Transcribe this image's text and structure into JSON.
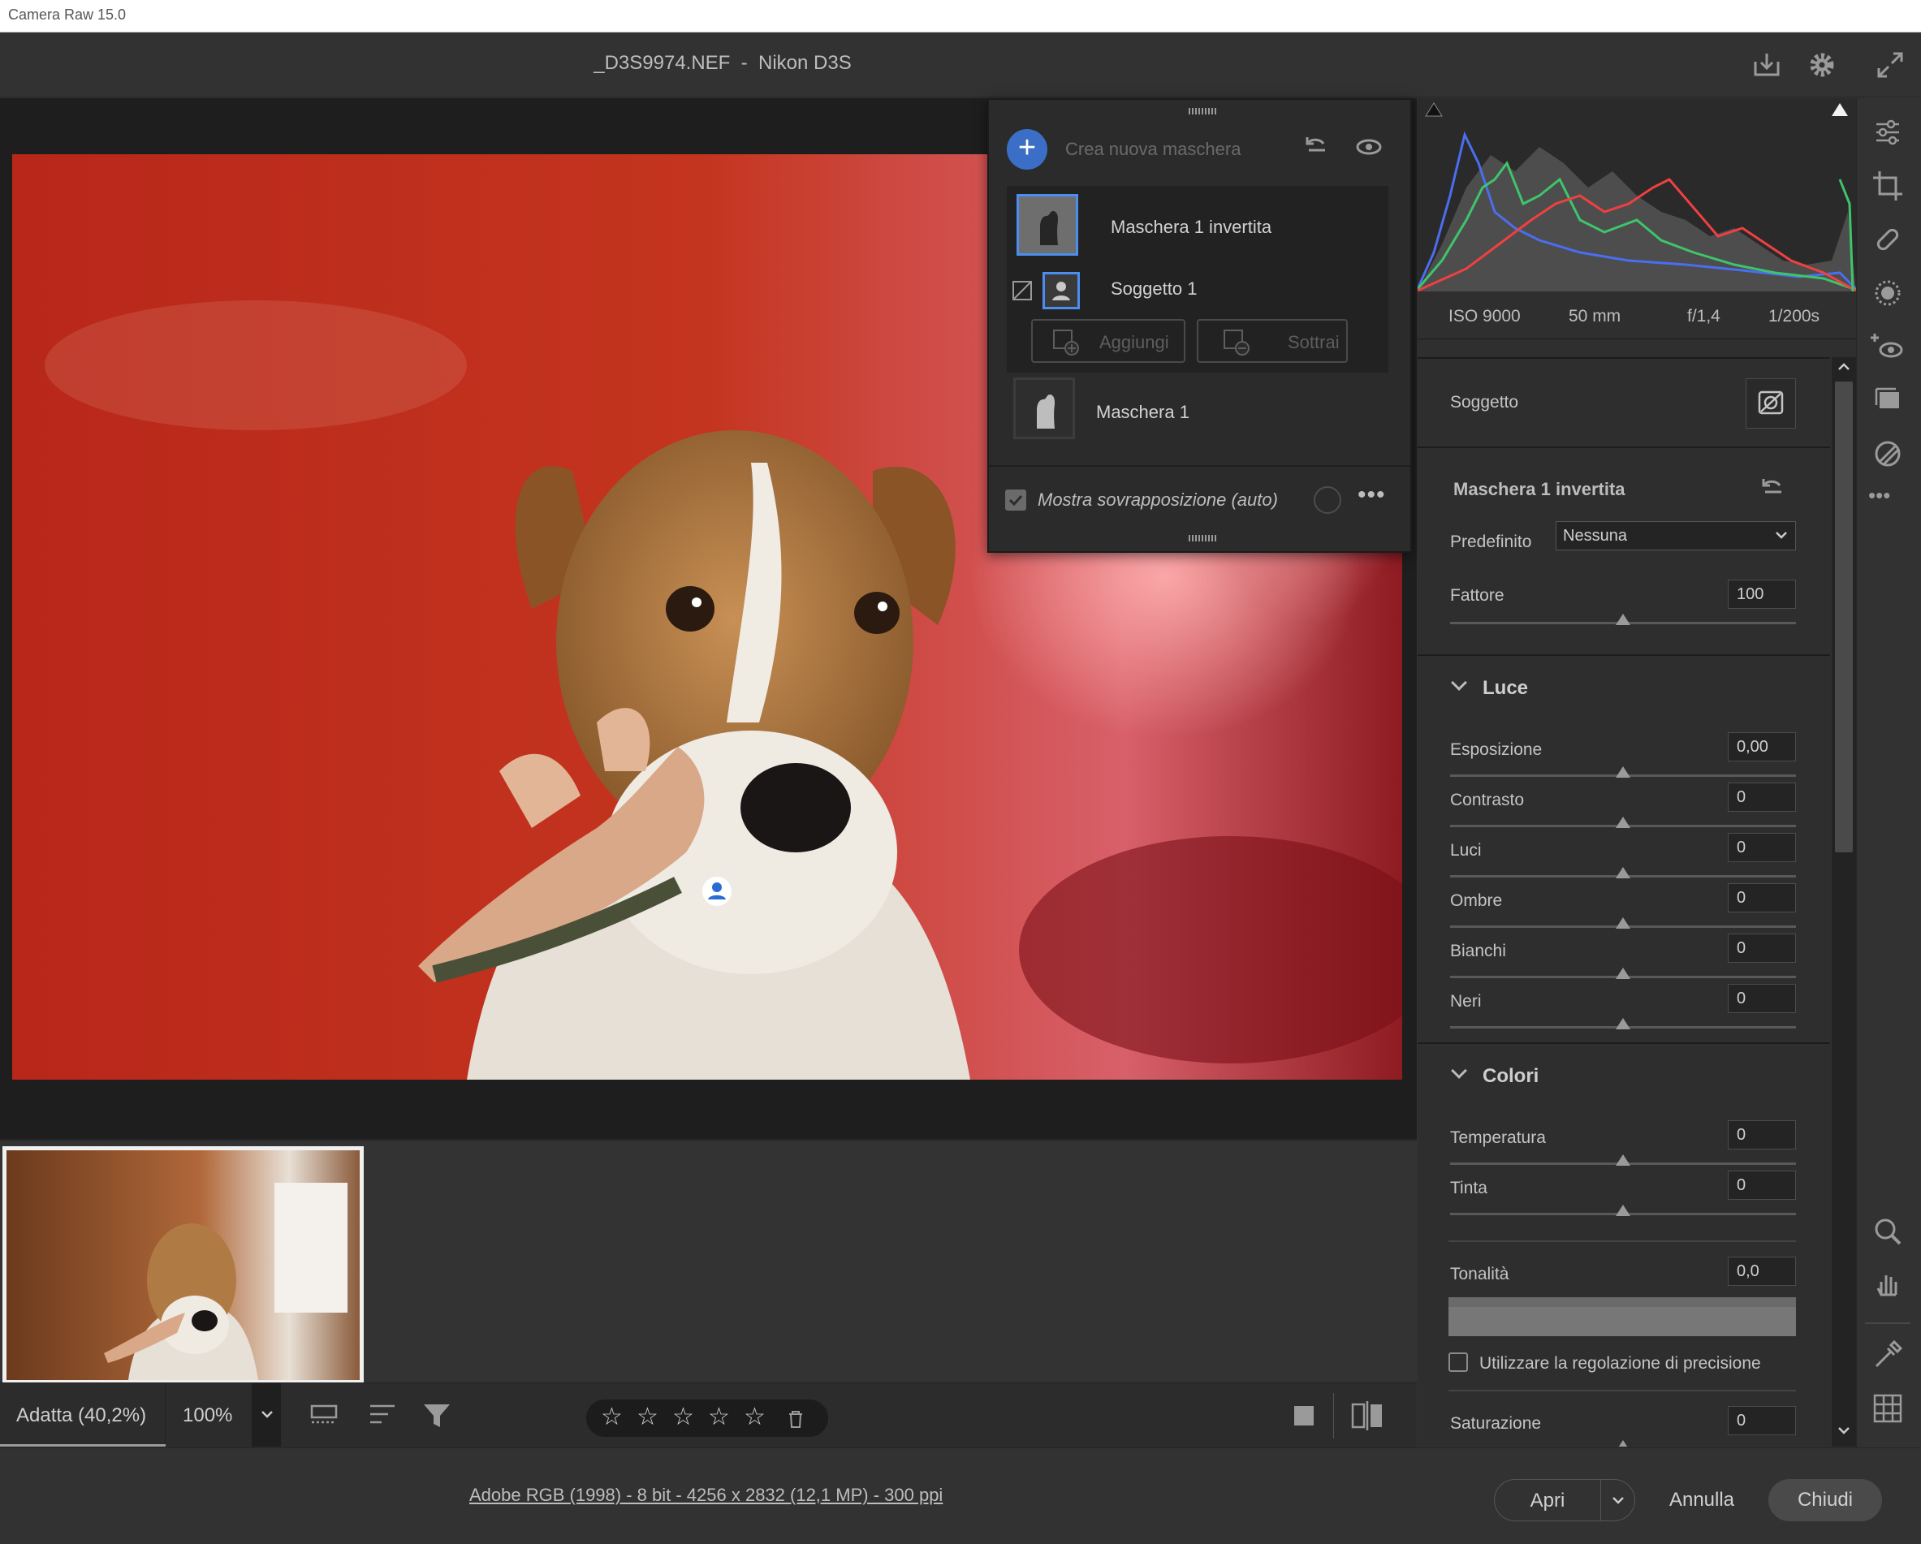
{
  "window": {
    "title": "Camera Raw 15.0"
  },
  "header": {
    "doc_title": "_D3S9974.NEF  -  Nikon D3S"
  },
  "masks": {
    "create_label": "Crea nuova maschera",
    "items": [
      {
        "name": "Maschera 1 invertita"
      },
      {
        "name": "Soggetto 1"
      },
      {
        "name": "Maschera 1"
      }
    ],
    "add_label": "Aggiungi",
    "subtract_label": "Sottrai",
    "overlay_label": "Mostra sovrapposizione (auto)",
    "overlay_checked": true
  },
  "exif": {
    "iso": "ISO 9000",
    "focal": "50 mm",
    "aperture": "f/1,4",
    "shutter": "1/200s"
  },
  "panel": {
    "subject_label": "Soggetto",
    "mask_title": "Maschera 1 invertita",
    "preset_label": "Predefinito",
    "preset_value": "Nessuna",
    "amount_label": "Fattore",
    "amount_value": "100",
    "light": {
      "title": "Luce",
      "sliders": [
        {
          "label": "Esposizione",
          "value": "0,00"
        },
        {
          "label": "Contrasto",
          "value": "0"
        },
        {
          "label": "Luci",
          "value": "0"
        },
        {
          "label": "Ombre",
          "value": "0"
        },
        {
          "label": "Bianchi",
          "value": "0"
        },
        {
          "label": "Neri",
          "value": "0"
        }
      ]
    },
    "color": {
      "title": "Colori",
      "sliders": [
        {
          "label": "Temperatura",
          "value": "0"
        },
        {
          "label": "Tinta",
          "value": "0"
        }
      ],
      "hue_label": "Tonalità",
      "hue_value": "0,0",
      "fine_adjust_label": "Utilizzare la regolazione di precisione",
      "saturation_label": "Saturazione",
      "saturation_value": "0"
    }
  },
  "bottombar": {
    "fit_label": "Adatta (40,2%)",
    "zoom_label": "100%"
  },
  "footer": {
    "file_info": "Adobe RGB (1998) - 8 bit - 4256 x 2832 (12,1 MP) - 300 ppi",
    "open_label": "Apri",
    "cancel_label": "Annulla",
    "close_label": "Chiudi"
  },
  "colors": {
    "accent": "#3b6fc7",
    "selection": "#4b8ef0"
  }
}
